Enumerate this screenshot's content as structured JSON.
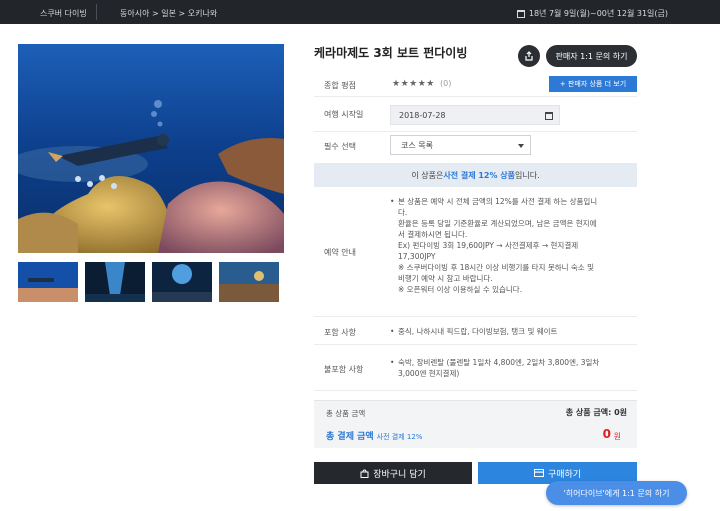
{
  "topbar": {
    "category": "스쿠버 다이빙",
    "breadcrumb": "동아시아 > 일본 > 오키나와",
    "period": "18년 7월 9일(월)~00년 12월 31일(금)"
  },
  "product": {
    "title": "케라마제도 3회 보트 펀다이빙",
    "inquiry_button": "판매자 1:1 문의 하기"
  },
  "rating": {
    "label": "종합 평점",
    "stars": "★★★★★",
    "count": "(0)",
    "more_button": "+ 판매자 상품 더 보기"
  },
  "date": {
    "label": "여행 시작일",
    "value": "2018-07-28"
  },
  "option": {
    "label": "필수 선택",
    "selected": "코스 목록"
  },
  "notice": {
    "prefix": "이 상품은 ",
    "highlight": "사전 결제 12% 상품",
    "suffix": "입니다."
  },
  "reservation": {
    "label": "예약 안내",
    "lines": [
      "본 상품은 예약 시 전체 금액의 12%를 사전 결제 하는 상품입니",
      "다.",
      "환율은 등록 당일 기준환율로 계산되었으며, 남은 금액은 현지에",
      "서 결제하시면 됩니다.",
      "Ex) 펀다이빙 3회 19,600JPY → 사전결제후 → 현지결제",
      "17,300JPY",
      "※ 스쿠버다이빙 후 18시간 이상 비행기를 타지 못하니 숙소 및",
      "비행기 예약 시 참고 바랍니다.",
      "※ 오픈워터 이상 이용하실 수 있습니다."
    ]
  },
  "included": {
    "label": "포함 사항",
    "text": "중식, 나하시내 픽드랍, 다이빙보험, 탱크 및 웨이트"
  },
  "excluded": {
    "label": "불포함 사항",
    "line1": "숙박, 장비렌탈 (풀렌탈 1일차 4,800엔, 2일차 3,800엔, 3일차",
    "line2": "3,000엔 현지결제)"
  },
  "totals": {
    "product_label": "총 상품 금액",
    "product_value": "총 상품 금액: 0원",
    "pay_label": "총 결제 금액",
    "pay_sub": "사전 결제 12%",
    "pay_value": "0",
    "pay_unit": "원"
  },
  "buttons": {
    "cart": "장바구니 담기",
    "buy": "구매하기",
    "chat": "'히어다이브'에게 1:1 문의 하기"
  },
  "colors": {
    "accent": "#2c79d6",
    "dark": "#25292e",
    "price": "#e02020"
  }
}
